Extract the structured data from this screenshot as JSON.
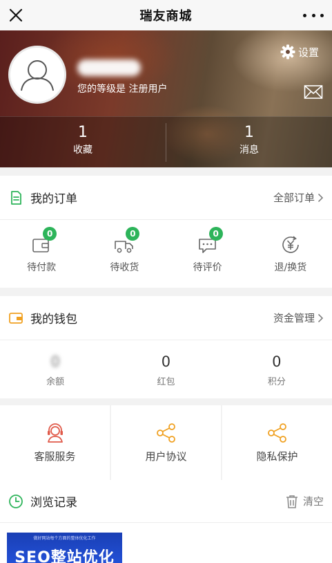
{
  "topbar": {
    "title": "瑞友商城"
  },
  "profile": {
    "level_text": "您的等级是 注册用户",
    "settings_label": "设置",
    "stats": [
      {
        "value": "1",
        "label": "收藏"
      },
      {
        "value": "1",
        "label": "消息"
      }
    ]
  },
  "orders": {
    "title": "我的订单",
    "link": "全部订单",
    "items": [
      {
        "label": "待付款",
        "badge": "0",
        "icon": "wallet-icon"
      },
      {
        "label": "待收货",
        "badge": "0",
        "icon": "truck-icon"
      },
      {
        "label": "待评价",
        "badge": "0",
        "icon": "comment-icon"
      },
      {
        "label": "退/换货",
        "icon": "yen-refund-icon"
      }
    ]
  },
  "wallet": {
    "title": "我的钱包",
    "link": "资金管理",
    "items": [
      {
        "value": "0",
        "label": "余额"
      },
      {
        "value": "0",
        "label": "红包"
      },
      {
        "value": "0",
        "label": "积分"
      }
    ]
  },
  "services": [
    {
      "label": "客服服务",
      "icon": "customer-service-icon"
    },
    {
      "label": "用户协议",
      "icon": "share-icon"
    },
    {
      "label": "隐私保护",
      "icon": "share-icon"
    }
  ],
  "history": {
    "title": "浏览记录",
    "clear_label": "清空",
    "thumb_small": "做好网站每个方面的整体优化工作",
    "thumb_big": "SEO整站优化"
  },
  "colors": {
    "accent_green": "#2db45a",
    "orange": "#f0a020",
    "red": "#e05a4a"
  }
}
